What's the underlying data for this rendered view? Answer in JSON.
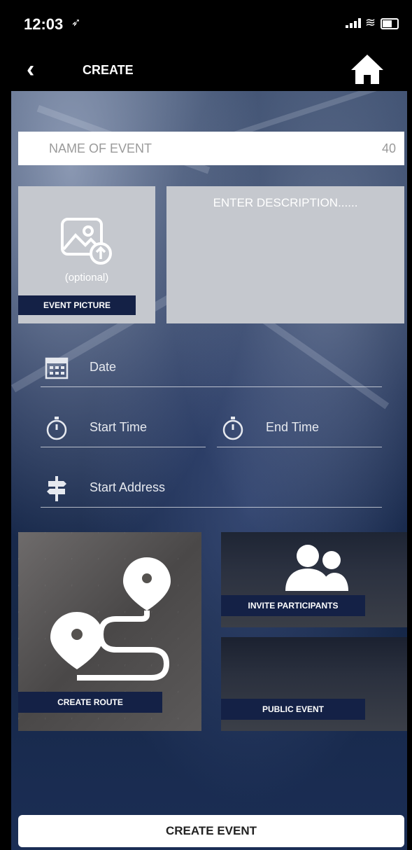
{
  "status_bar": {
    "time": "12:03",
    "location_icon": "location-arrow-icon",
    "signal_icon": "signal-icon",
    "wifi_icon": "wifi-icon",
    "battery_icon": "battery-icon"
  },
  "nav": {
    "back_icon": "chevron-left-icon",
    "title": "CREATE",
    "home_icon": "home-icon"
  },
  "form": {
    "name_placeholder": "NAME OF EVENT",
    "name_char_count": "40",
    "picture_optional": "(optional)",
    "picture_label": "EVENT PICTURE",
    "description_placeholder": "ENTER DESCRIPTION......",
    "date_label": "Date",
    "start_time_label": "Start Time",
    "end_time_label": "End Time",
    "start_address_label": "Start Address"
  },
  "tiles": {
    "create_route": "CREATE ROUTE",
    "invite_participants": "INVITE PARTICIPANTS",
    "public_event": "PUBLIC EVENT"
  },
  "actions": {
    "create_event": "CREATE EVENT"
  },
  "colors": {
    "label_bg": "#142146",
    "box_bg": "#c5c8ce",
    "bar_bg": "#000000"
  }
}
